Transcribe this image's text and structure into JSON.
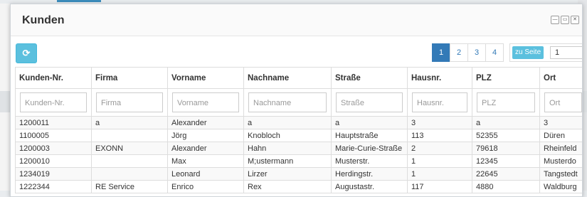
{
  "dialog": {
    "title": "Kunden"
  },
  "window_buttons": [
    "—",
    "▭",
    "✕"
  ],
  "toolbar": {
    "refresh_icon": "refresh-icon",
    "pages": [
      "1",
      "2",
      "3",
      "4"
    ],
    "active_page": "1",
    "goto_label": "zu Seite",
    "goto_value": "1"
  },
  "table": {
    "columns": [
      "Kunden-Nr.",
      "Firma",
      "Vorname",
      "Nachname",
      "Straße",
      "Hausnr.",
      "PLZ",
      "Ort"
    ],
    "filters": [
      "Kunden-Nr.",
      "Firma",
      "Vorname",
      "Nachname",
      "Straße",
      "Hausnr.",
      "PLZ",
      "Ort"
    ],
    "rows": [
      [
        "1200011",
        "a",
        "Alexander",
        "a",
        "a",
        "3",
        "a",
        "3"
      ],
      [
        "1100005",
        "",
        "Jörg",
        "Knobloch",
        "Hauptstraße",
        "113",
        "52355",
        "Düren"
      ],
      [
        "1200003",
        "EXONN",
        "Alexander",
        "Hahn",
        "Marie-Curie-Straße",
        "2",
        "79618",
        "Rheinfeld"
      ],
      [
        "1200010",
        "",
        "Max",
        "M;ustermann",
        "Musterstr.",
        "1",
        "12345",
        "Musterdo"
      ],
      [
        "1234019",
        "",
        "Leonard",
        "Lirzer",
        "Herdingstr.",
        "1",
        "22645",
        "Tangstedt"
      ],
      [
        "1222344",
        "RE Service",
        "Enrico",
        "Rex",
        "Augustastr.",
        "117",
        "4880",
        "Waldburg"
      ]
    ]
  },
  "colors": {
    "primary": "#337ab7",
    "info": "#5bc0de"
  }
}
